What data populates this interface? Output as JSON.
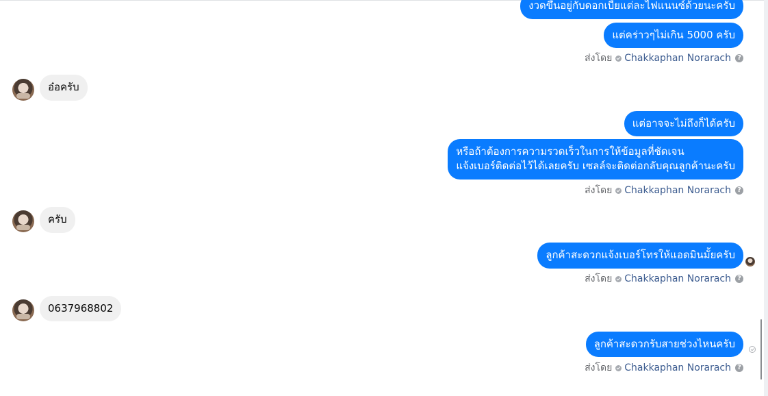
{
  "sender_name": "Chakkaphan Norarach",
  "sent_by_label": "ส่งโดย",
  "help_glyph": "?",
  "colors": {
    "outgoing_bubble": "#0a7cff",
    "incoming_bubble": "#f0f0f0",
    "sent_by_name": "#3b5b8f"
  },
  "messages": [
    {
      "direction": "out",
      "lines": [
        "งวดขึ้นอยู่กับดอกเบี้ยแต่ละไฟแนนซ์ด้วยนะครับ"
      ]
    },
    {
      "direction": "out",
      "lines": [
        "แต่คร่าวๆไม่เกิน 5000 ครับ"
      ]
    },
    {
      "direction": "in",
      "lines": [
        "อ๋อครับ"
      ]
    },
    {
      "direction": "out",
      "lines": [
        "แต่อาจจะไม่ถึงก็ได้ครับ"
      ]
    },
    {
      "direction": "out",
      "lines": [
        "หรือถ้าต้องการความรวดเร็วในการให้ข้อมูลที่ชัดเจน",
        "แจ้งเบอร์ติดต่อไว้ได้เลยครับ เซลล์จะติดต่อกลับคุณลูกค้านะครับ"
      ]
    },
    {
      "direction": "in",
      "lines": [
        "ครับ"
      ]
    },
    {
      "direction": "out",
      "lines": [
        "ลูกค้าสะดวกแจ้งเบอร์โทรให้แอดมินมั้ยครับ"
      ],
      "status": "seen"
    },
    {
      "direction": "in",
      "lines": [
        "0637968802"
      ]
    },
    {
      "direction": "out",
      "lines": [
        "ลูกค้าสะดวกรับสายช่วงไหนครับ"
      ],
      "status": "delivered"
    }
  ]
}
